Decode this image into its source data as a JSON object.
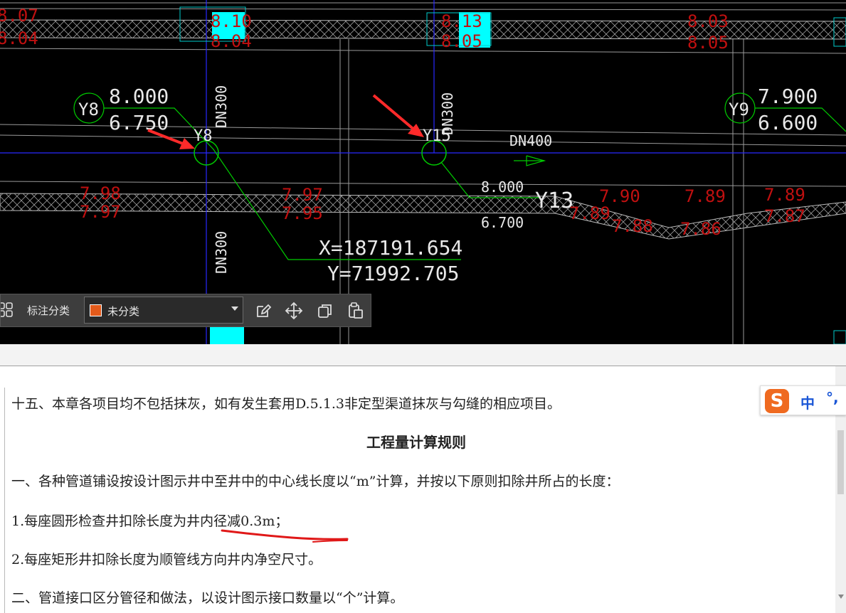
{
  "cad": {
    "well_left": {
      "id": "Y8",
      "label": "Y8",
      "top": "8.000",
      "bottom": "6.750"
    },
    "well_mid": {
      "label": "Y15"
    },
    "well_right": {
      "id": "Y9",
      "top": "7.900",
      "bottom": "6.600"
    },
    "well_y13": {
      "id": "Y13",
      "top": "8.000",
      "bottom": "6.700"
    },
    "pipe_labels": {
      "dn300_a": "DN300",
      "dn300_b": "DN300",
      "dn300_c": "DN300",
      "dn400": "DN400"
    },
    "coord_x": "X=187191.654",
    "coord_y": "Y=71992.705",
    "upper_road": {
      "a1": "8.07",
      "a2": "8.04",
      "b1": "8.10",
      "b2": "8.04",
      "c1": "8.13",
      "c2": "8.05",
      "d1": "8.03",
      "d2": "8.05"
    },
    "lower_road": {
      "e1": "7.98",
      "e2": "7.97",
      "f1": "7.97",
      "f2": "7.95",
      "g1": "7.90",
      "g2": "7.89",
      "h": "7.88",
      "i1": "7.89",
      "i2": "7.86",
      "j1": "7.89",
      "j2": "7.87"
    }
  },
  "toolbar": {
    "category_label": "标注分类",
    "selected_category": "未分类",
    "swatch_color": "#e35a1a"
  },
  "document": {
    "line_top": "十五、本章各项目均不包括抹灰，如有发生套用D.5.1.3非定型渠道抹灰与勾缝的相应项目。",
    "heading": "工程量计算规则",
    "line1": "一、各种管道铺设按设计图示井中至井中的中心线长度以“m”计算，并按以下原则扣除井所占的长度：",
    "line2": "1.每座圆形检查井扣除长度为井内径减0.3m；",
    "line3": "2.每座矩形井扣除长度为顺管线方向井内净空尺寸。",
    "line4": "二、管道接口区分管径和做法，以设计图示接口数量以“个”计算。"
  },
  "ime": {
    "logo": "S",
    "mode": "中",
    "punct": "°,"
  },
  "colors": {
    "annotation_red": "#ff2a2a",
    "cad_green": "#00cc00",
    "cad_blue": "#3030ff",
    "cyan_block": "#00ffff",
    "elevation_red": "#c01010"
  }
}
